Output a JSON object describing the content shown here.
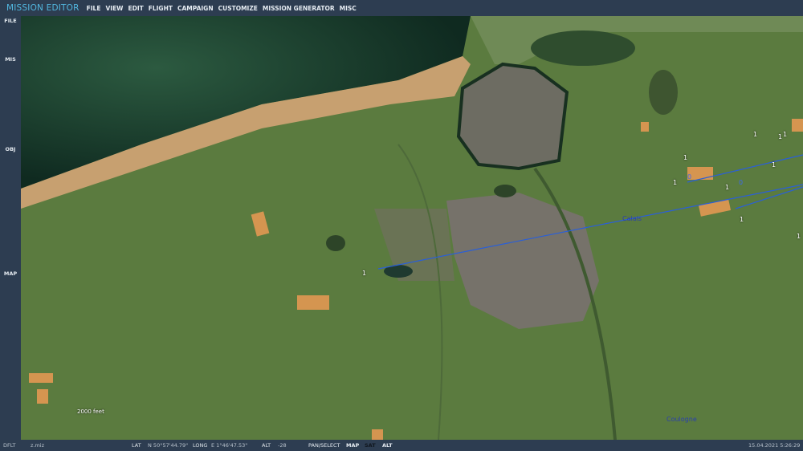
{
  "app_title": "MISSION EDITOR",
  "menu": [
    "FILE",
    "VIEW",
    "EDIT",
    "FLIGHT",
    "CAMPAIGN",
    "CUSTOMIZE",
    "MISSION GENERATOR",
    "MISC"
  ],
  "sidebar": [
    "FILE",
    "MIS",
    "OBJ",
    "MAP"
  ],
  "map": {
    "cities": [
      "Calais",
      "Coulogne"
    ],
    "scale": "2000 feet",
    "markers": [
      "1",
      "1",
      "1",
      "1",
      "1",
      "1",
      "1",
      "1",
      "1",
      "1",
      "0",
      "0"
    ]
  },
  "status": {
    "profile": "DFLT",
    "file": "z.miz",
    "lat_label": "LAT",
    "lat": "N 50°57'44.79\"",
    "long_label": "LONG",
    "long": "E  1°46'47.53\"",
    "alt_label": "ALT",
    "alt": "-28",
    "modes": [
      "PAN/SELECT",
      "MAP",
      "SAT",
      "ALT"
    ],
    "active_mode": "SAT",
    "datetime": "15.04.2021 5:26:29"
  }
}
